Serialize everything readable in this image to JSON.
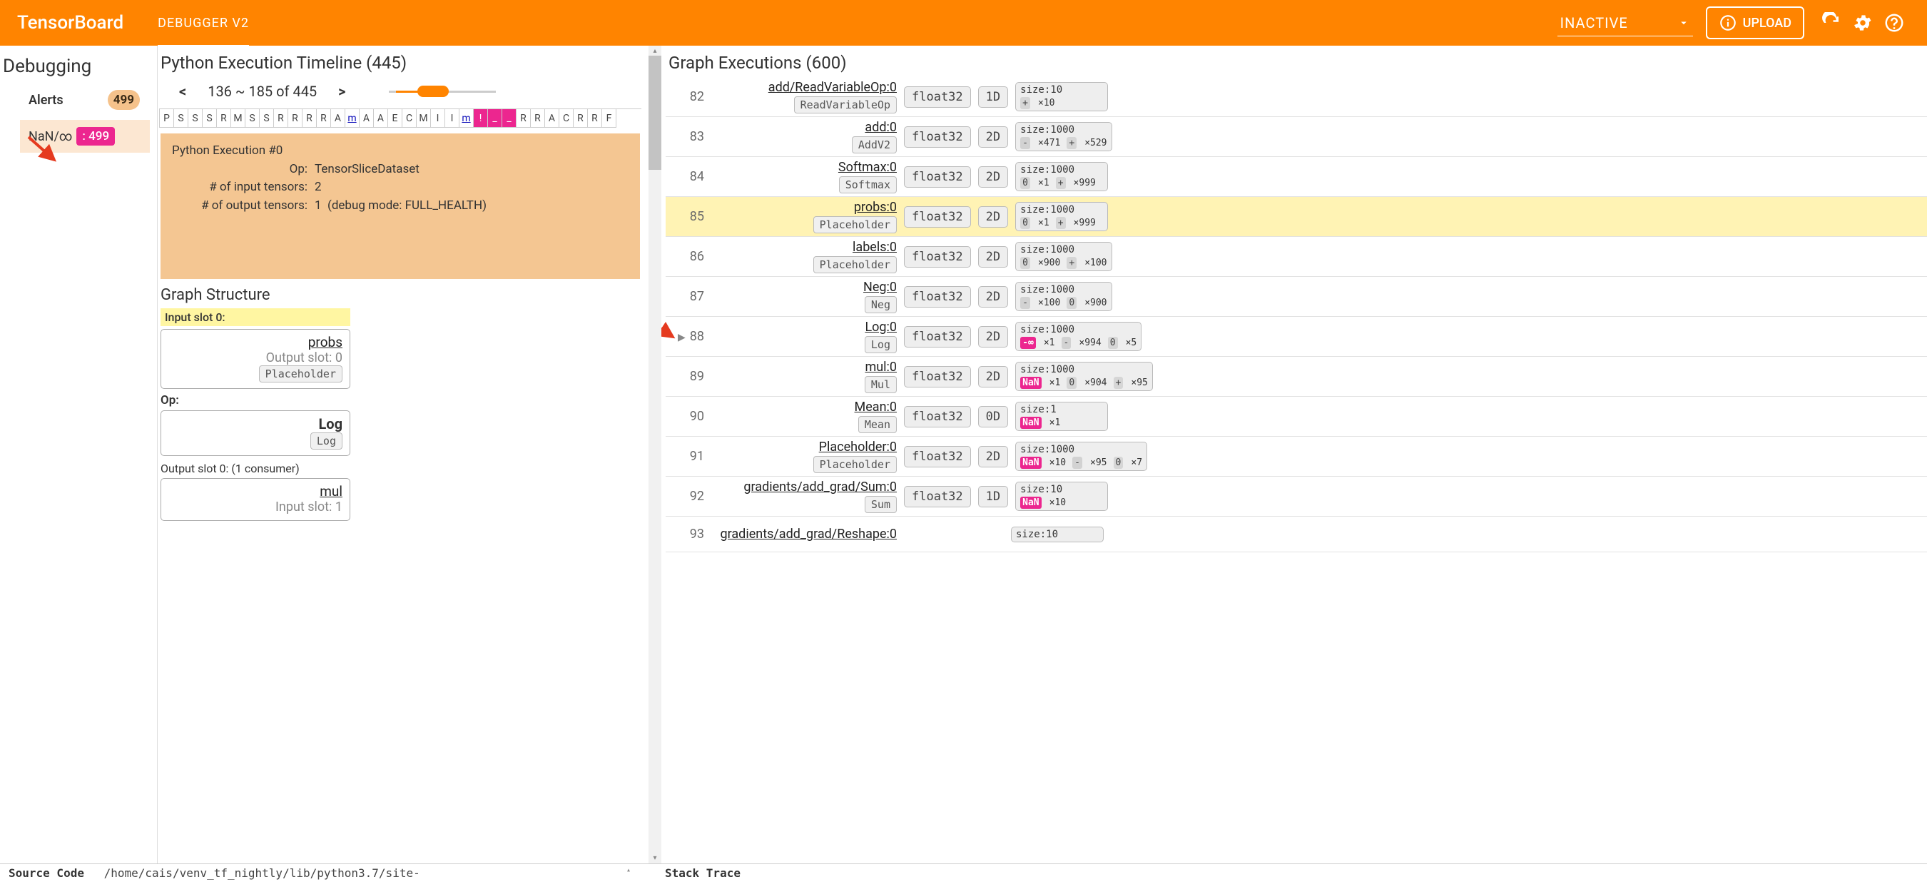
{
  "header": {
    "brand": "TensorBoard",
    "plugin": "DEBUGGER V2",
    "runs_label": "INACTIVE",
    "upload": "UPLOAD"
  },
  "sidebar": {
    "title": "Debugging",
    "alerts_label": "Alerts",
    "alerts_count": "499",
    "alert_type": "NaN/∞",
    "alert_type_count": ": 499"
  },
  "timeline": {
    "title": "Python Execution Timeline (445)",
    "prev": "<",
    "range": "136 ~ 185 of 445",
    "next": ">",
    "cells": [
      "P",
      "S",
      "S",
      "S",
      "R",
      "M",
      "S",
      "S",
      "R",
      "R",
      "R",
      "R",
      "A",
      "m",
      "A",
      "A",
      "E",
      "C",
      "M",
      "I",
      "I",
      "m",
      "!",
      "_",
      "_",
      "R",
      "R",
      "A",
      "C",
      "R",
      "R",
      "F"
    ],
    "hl_idx": [
      22,
      23,
      24
    ],
    "link_idx": [
      13,
      21
    ],
    "exec": {
      "title": "Python Execution #0",
      "op_k": "Op:",
      "op_v": "TensorSliceDataset",
      "in_k": "# of input tensors:",
      "in_v": "2",
      "out_k": "# of output tensors:",
      "out_v": "1",
      "debug": "(debug mode: FULL_HEALTH)"
    }
  },
  "graph_struct": {
    "title": "Graph Structure",
    "input_slot": "Input slot 0:",
    "in_name": "probs",
    "in_sub": "Output slot: 0",
    "in_chip": "Placeholder",
    "op_label": "Op:",
    "op_main": "Log",
    "op_chip": "Log",
    "output_slot": "Output slot 0: (1 consumer)",
    "out_name": "mul",
    "out_sub": "Input slot: 1"
  },
  "graph_exec": {
    "title": "Graph Executions (600)",
    "rows": [
      {
        "idx": "82",
        "name": "add/ReadVariableOp:0",
        "chip": "ReadVariableOp",
        "dtype": "float32",
        "rank": "1D",
        "size": "size:10",
        "minis": [
          {
            "t": "+",
            "c": "zero"
          },
          {
            "v": "×10"
          }
        ]
      },
      {
        "idx": "83",
        "name": "add:0",
        "chip": "AddV2",
        "dtype": "float32",
        "rank": "2D",
        "size": "size:1000",
        "minis": [
          {
            "t": "-",
            "c": "neg"
          },
          {
            "v": "×471"
          },
          {
            "t": "+",
            "c": "zero"
          },
          {
            "v": "×529"
          }
        ]
      },
      {
        "idx": "84",
        "name": "Softmax:0",
        "chip": "Softmax",
        "dtype": "float32",
        "rank": "2D",
        "size": "size:1000",
        "minis": [
          {
            "t": "0",
            "c": "zero"
          },
          {
            "v": "×1"
          },
          {
            "t": "+",
            "c": "zero"
          },
          {
            "v": "×999"
          }
        ]
      },
      {
        "idx": "85",
        "name": "probs:0",
        "chip": "Placeholder",
        "dtype": "float32",
        "rank": "2D",
        "size": "size:1000",
        "hl": true,
        "minis": [
          {
            "t": "0",
            "c": "zero"
          },
          {
            "v": "×1"
          },
          {
            "t": "+",
            "c": "zero"
          },
          {
            "v": "×999"
          }
        ]
      },
      {
        "idx": "86",
        "name": "labels:0",
        "chip": "Placeholder",
        "dtype": "float32",
        "rank": "2D",
        "size": "size:1000",
        "minis": [
          {
            "t": "0",
            "c": "zero"
          },
          {
            "v": "×900"
          },
          {
            "t": "+",
            "c": "zero"
          },
          {
            "v": "×100"
          }
        ]
      },
      {
        "idx": "87",
        "name": "Neg:0",
        "chip": "Neg",
        "dtype": "float32",
        "rank": "2D",
        "size": "size:1000",
        "minis": [
          {
            "t": "-",
            "c": "neg"
          },
          {
            "v": "×100"
          },
          {
            "t": "0",
            "c": "zero"
          },
          {
            "v": "×900"
          }
        ]
      },
      {
        "idx": "88",
        "name": "Log:0",
        "chip": "Log",
        "dtype": "float32",
        "rank": "2D",
        "size": "size:1000",
        "focus": true,
        "minis": [
          {
            "t": "-∞",
            "c": "pink"
          },
          {
            "v": "×1"
          },
          {
            "t": "-",
            "c": "neg"
          },
          {
            "v": "×994"
          },
          {
            "t": "0",
            "c": "zero"
          },
          {
            "v": "×5"
          }
        ]
      },
      {
        "idx": "89",
        "name": "mul:0",
        "chip": "Mul",
        "dtype": "float32",
        "rank": "2D",
        "size": "size:1000",
        "minis": [
          {
            "t": "NaN",
            "c": "pink"
          },
          {
            "v": "×1"
          },
          {
            "t": "0",
            "c": "zero"
          },
          {
            "v": "×904"
          },
          {
            "t": "+",
            "c": "zero"
          },
          {
            "v": "×95"
          }
        ]
      },
      {
        "idx": "90",
        "name": "Mean:0",
        "chip": "Mean",
        "dtype": "float32",
        "rank": "0D",
        "size": "size:1",
        "minis": [
          {
            "t": "NaN",
            "c": "pink"
          },
          {
            "v": "×1"
          }
        ]
      },
      {
        "idx": "91",
        "name": "Placeholder:0",
        "chip": "Placeholder",
        "dtype": "float32",
        "rank": "2D",
        "size": "size:1000",
        "minis": [
          {
            "t": "NaN",
            "c": "pink"
          },
          {
            "v": "×10"
          },
          {
            "t": "-",
            "c": "neg"
          },
          {
            "v": "×95"
          },
          {
            "t": "0",
            "c": "zero"
          },
          {
            "v": "×7"
          }
        ]
      },
      {
        "idx": "92",
        "name": "gradients/add_grad/Sum:0",
        "chip": "Sum",
        "dtype": "float32",
        "rank": "1D",
        "size": "size:10",
        "minis": [
          {
            "t": "NaN",
            "c": "pink"
          },
          {
            "v": "×10"
          }
        ]
      },
      {
        "idx": "93",
        "name": "gradients/add_grad/Reshape:0",
        "chip": "",
        "dtype": "",
        "rank": "",
        "size": "size:10",
        "minis": []
      }
    ]
  },
  "bottom": {
    "source": "Source Code",
    "path": "/home/cais/venv_tf_nightly/lib/python3.7/site-",
    "stack": "Stack Trace"
  }
}
